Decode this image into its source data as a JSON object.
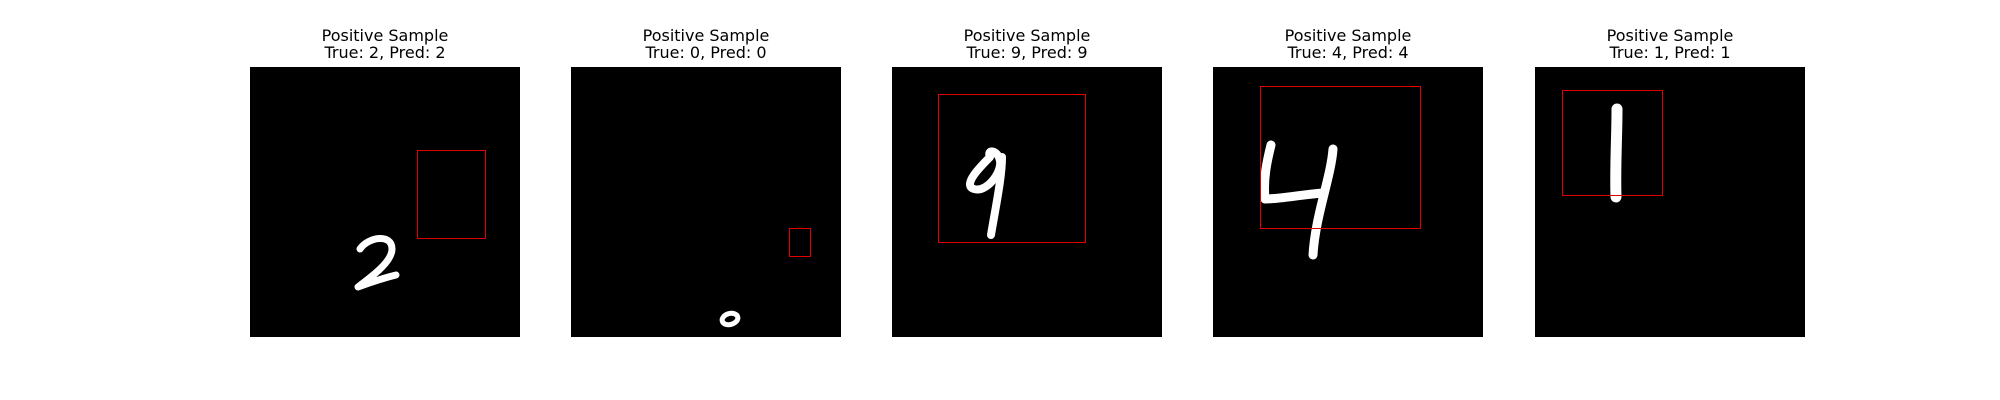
{
  "panels": [
    {
      "title_line1": "Positive Sample",
      "title_line2": "True: 2, Pred: 2",
      "digit": "2"
    },
    {
      "title_line1": "Positive Sample",
      "title_line2": "True: 0, Pred: 0",
      "digit": "0"
    },
    {
      "title_line1": "Positive Sample",
      "title_line2": "True: 9, Pred: 9",
      "digit": "9"
    },
    {
      "title_line1": "Positive Sample",
      "title_line2": "True: 4, Pred: 4",
      "digit": "4"
    },
    {
      "title_line1": "Positive Sample",
      "title_line2": "True: 1, Pred: 1",
      "digit": "1"
    }
  ],
  "colors": {
    "background": "#000000",
    "digit_stroke": "#ffffff",
    "box": "#e00000"
  }
}
